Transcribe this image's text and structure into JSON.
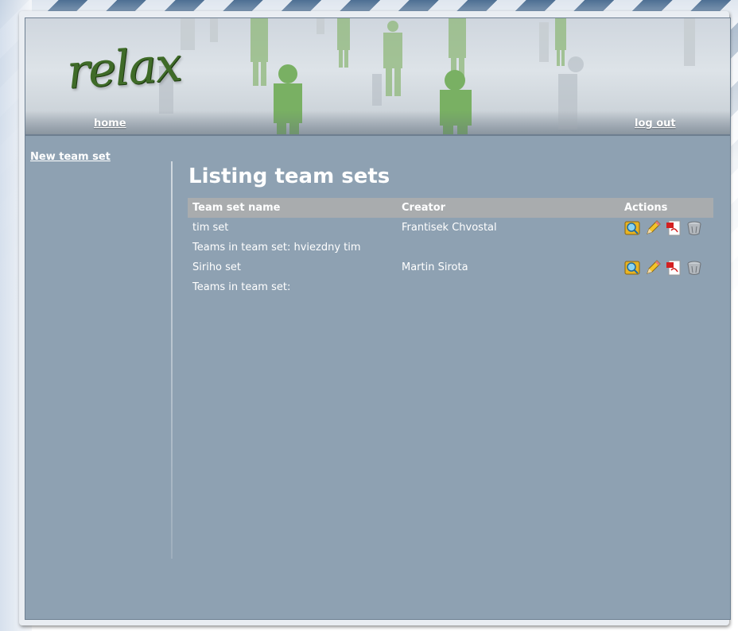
{
  "header": {
    "logo_text": "relax",
    "nav_home": "home",
    "nav_logout": "log out"
  },
  "sidebar": {
    "new_team_set_link": "New team set"
  },
  "main": {
    "title": "Listing team sets",
    "columns": [
      "Team set name",
      "Creator",
      "Actions"
    ],
    "rows": [
      {
        "name": "tim set",
        "creator": "Frantisek Chvostal",
        "teams_line": "Teams in team set: hviezdny tim",
        "actions": [
          "show-icon",
          "edit-icon",
          "pdf-icon",
          "delete-icon"
        ]
      },
      {
        "name": "Siriho set",
        "creator": "Martin Sirota",
        "teams_line": "Teams in team set:",
        "actions": [
          "show-icon",
          "edit-icon",
          "pdf-icon",
          "delete-icon"
        ]
      }
    ]
  },
  "colors": {
    "panel": "#8ea1b2",
    "table_header": "#a9acae",
    "logo_green": "#3f6b28",
    "figure_green": "#79b063"
  }
}
